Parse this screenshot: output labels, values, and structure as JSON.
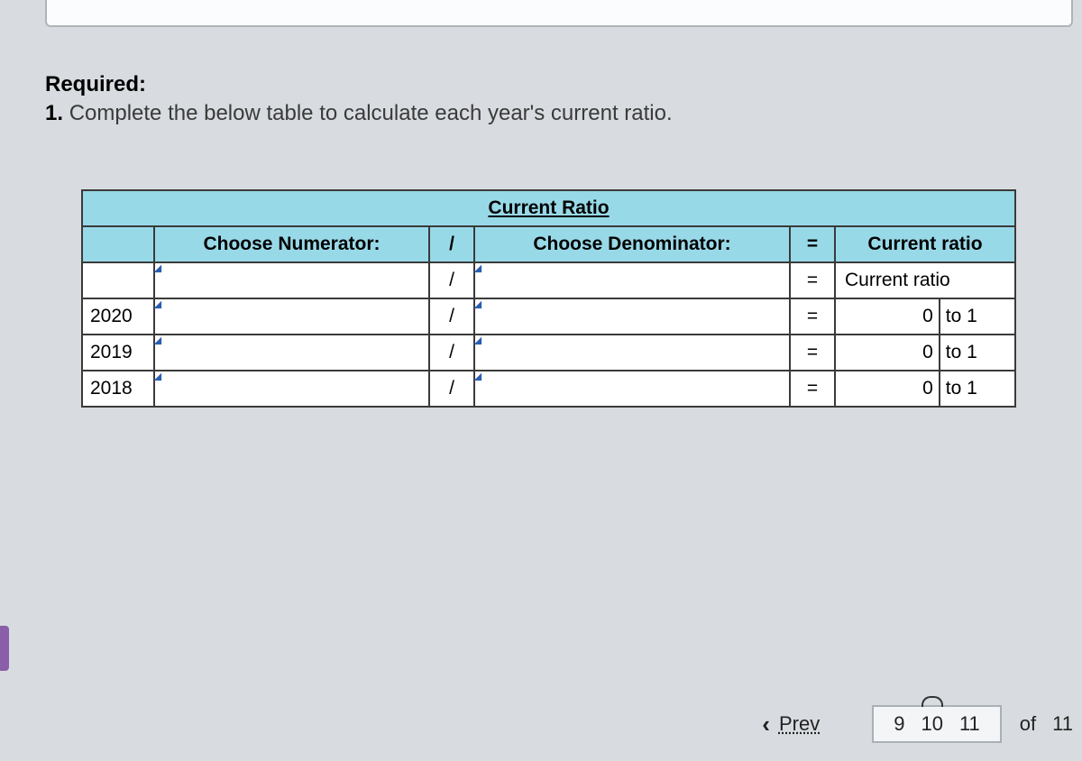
{
  "instructions": {
    "required_label": "Required:",
    "number": "1.",
    "text": "Complete the below table to calculate each year's current ratio."
  },
  "table": {
    "title": "Current Ratio",
    "headers": {
      "numerator": "Choose Numerator:",
      "slash": "/",
      "denominator": "Choose Denominator:",
      "equals": "=",
      "ratio": "Current ratio"
    },
    "row_header2": {
      "slash": "/",
      "equals": "=",
      "ratio": "Current ratio"
    },
    "rows": [
      {
        "year": "2020",
        "slash": "/",
        "equals": "=",
        "value": "0",
        "to": "to 1"
      },
      {
        "year": "2019",
        "slash": "/",
        "equals": "=",
        "value": "0",
        "to": "to 1"
      },
      {
        "year": "2018",
        "slash": "/",
        "equals": "=",
        "value": "0",
        "to": "to 1"
      }
    ]
  },
  "nav": {
    "prev": "Prev",
    "page_before": "9",
    "page_current": "10",
    "page_after": "11",
    "of": "of",
    "total": "11"
  }
}
